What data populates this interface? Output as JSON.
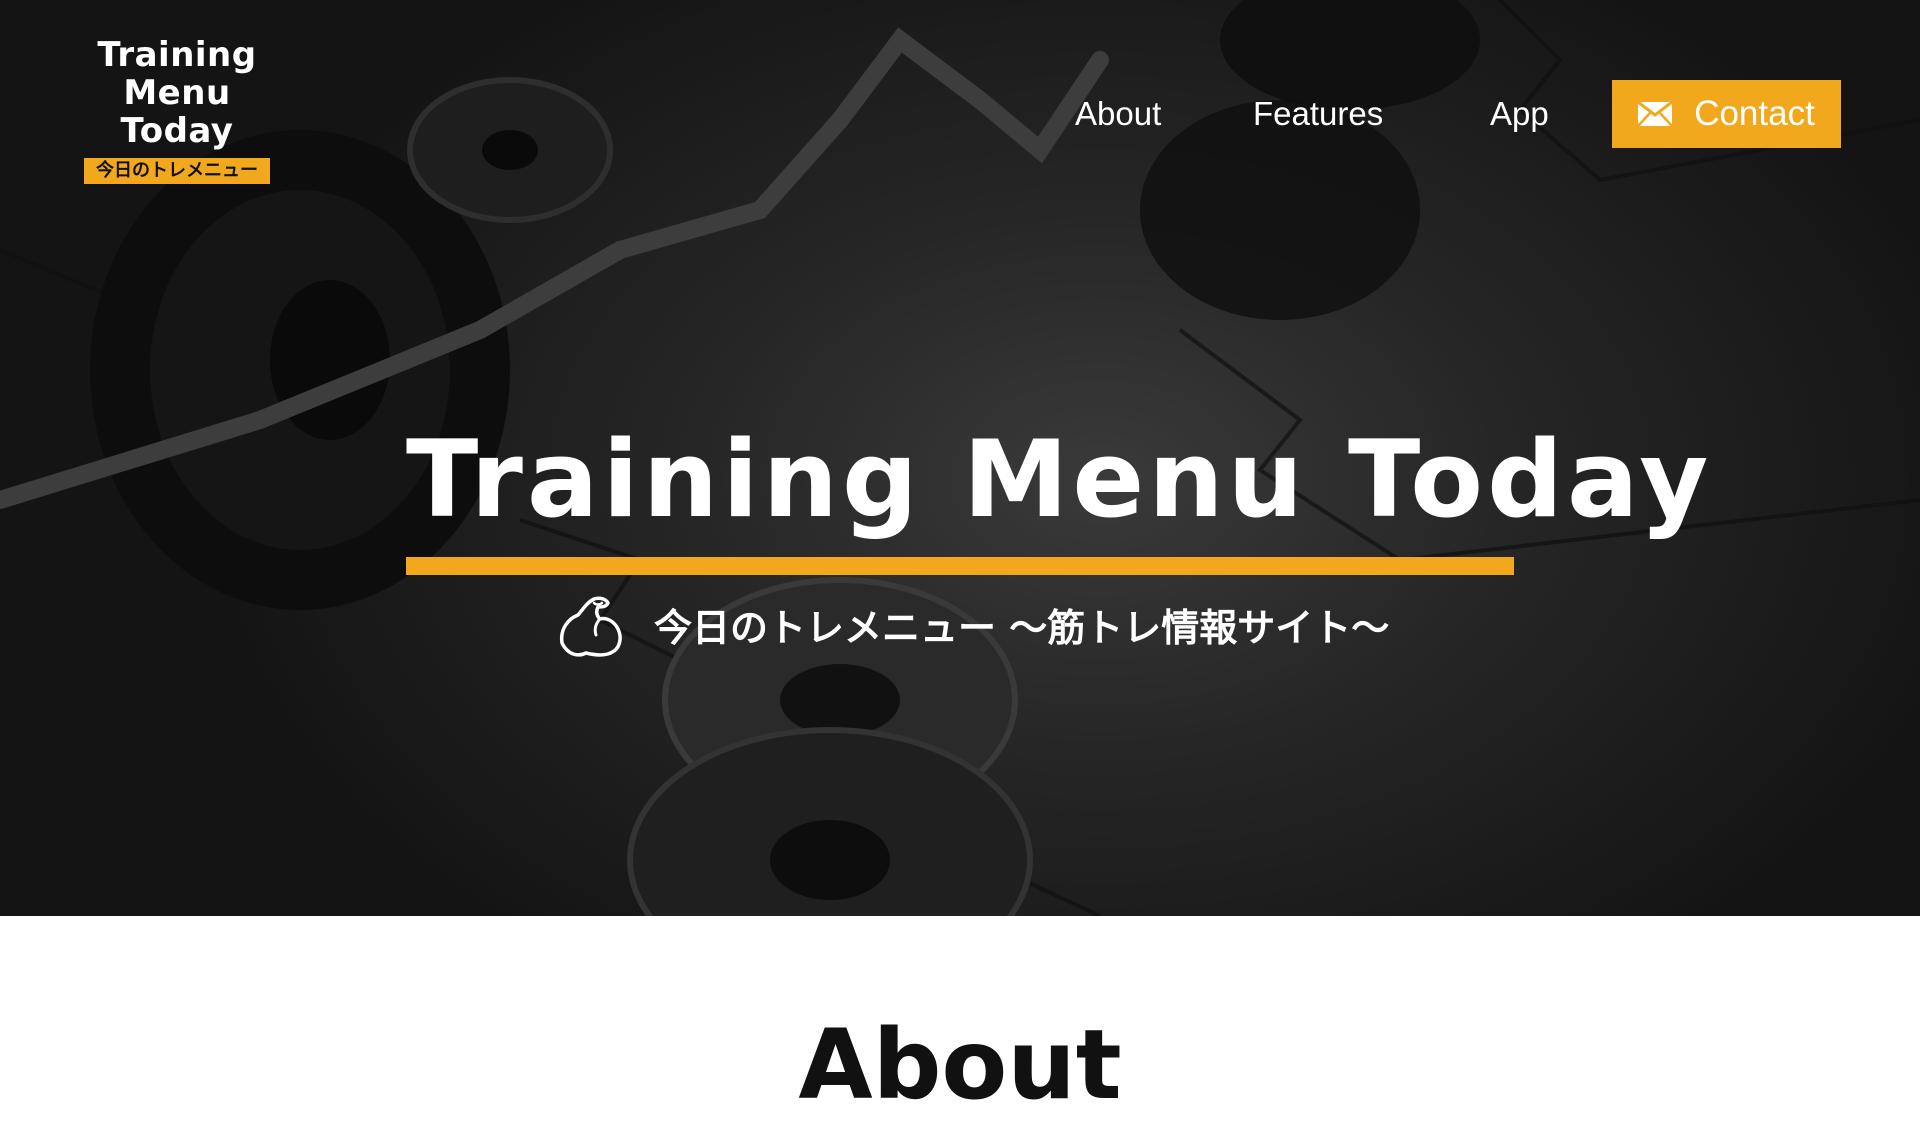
{
  "header": {
    "logo": {
      "line1": "Training",
      "line2": "Menu",
      "line3": "Today",
      "badge": "今日のトレメニュー"
    },
    "nav": {
      "about": "About",
      "features": "Features",
      "app": "App",
      "contact": "Contact"
    }
  },
  "hero": {
    "title": "Training Menu Today",
    "subtitle": "今日のトレメニュー 〜筋トレ情報サイト〜"
  },
  "about": {
    "heading": "About"
  },
  "theme": {
    "accent": "#f2a81d",
    "hero_background": "#1b1b1b",
    "text_on_dark": "#ffffff",
    "text_on_light": "#111111"
  },
  "icons": {
    "contact": "mail-icon",
    "subtitle": "muscle-arm-icon"
  }
}
